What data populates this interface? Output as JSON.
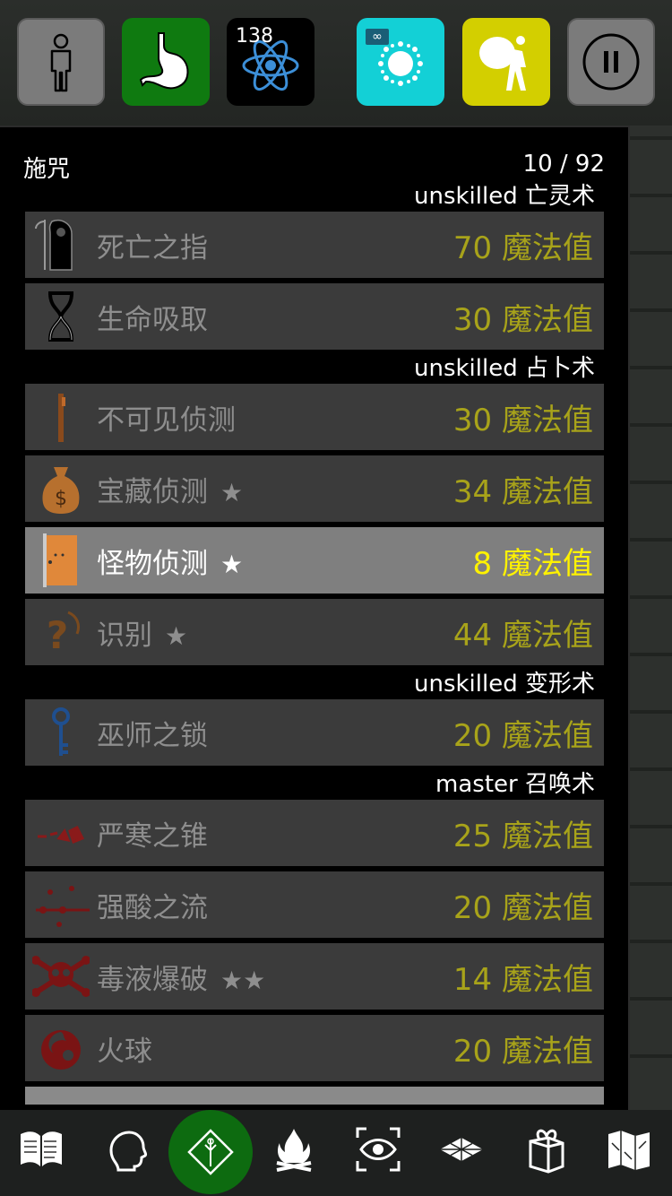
{
  "top_bar": {
    "character": {
      "icon": "person-icon"
    },
    "hunger": {
      "icon": "stomach-icon"
    },
    "radiation": {
      "icon": "atom-icon",
      "count": "138"
    },
    "status": {
      "icon": "sparkle-icon",
      "badge": "∞"
    },
    "burden": {
      "icon": "burden-icon"
    },
    "pause": {
      "icon": "pause-icon"
    }
  },
  "panel": {
    "title": "施咒",
    "count": "10 / 92"
  },
  "schools": [
    {
      "header": "unskilled 亡灵术",
      "spells": [
        {
          "name": "死亡之指",
          "stars": "",
          "cost": "70 魔法值",
          "icon": "reaper-icon",
          "selected": false
        },
        {
          "name": "生命吸取",
          "stars": "",
          "cost": "30 魔法值",
          "icon": "hourglass-icon",
          "selected": false
        }
      ]
    },
    {
      "header": "unskilled 占卜术",
      "spells": [
        {
          "name": "不可见侦测",
          "stars": "",
          "cost": "30 魔法值",
          "icon": "rod-icon",
          "selected": false
        },
        {
          "name": "宝藏侦测",
          "stars": "★",
          "cost": "34 魔法值",
          "icon": "money-bag-icon",
          "selected": false
        },
        {
          "name": "怪物侦测",
          "stars": "★",
          "cost": "8 魔法值",
          "icon": "door-icon",
          "selected": true
        },
        {
          "name": "识别",
          "stars": "★",
          "cost": "44 魔法值",
          "icon": "question-icon",
          "selected": false
        }
      ]
    },
    {
      "header": "unskilled 变形术",
      "spells": [
        {
          "name": "巫师之锁",
          "stars": "",
          "cost": "20 魔法值",
          "icon": "key-icon",
          "selected": false
        }
      ]
    },
    {
      "header": "master 召唤术",
      "spells": [
        {
          "name": "严寒之锥",
          "stars": "",
          "cost": "25 魔法值",
          "icon": "cone-icon",
          "selected": false
        },
        {
          "name": "强酸之流",
          "stars": "",
          "cost": "20 魔法值",
          "icon": "acid-icon",
          "selected": false
        },
        {
          "name": "毒液爆破",
          "stars": "★★",
          "cost": "14 魔法值",
          "icon": "skull-icon",
          "selected": false
        },
        {
          "name": "火球",
          "stars": "",
          "cost": "20 魔法值",
          "icon": "fireball-icon",
          "selected": false
        }
      ]
    }
  ],
  "bottom_bar": [
    {
      "icon": "book-icon"
    },
    {
      "icon": "head-icon"
    },
    {
      "icon": "spell-diamond-icon",
      "active": true
    },
    {
      "icon": "campfire-icon"
    },
    {
      "icon": "look-eye-icon"
    },
    {
      "icon": "floor-tiles-icon"
    },
    {
      "icon": "gift-icon"
    },
    {
      "icon": "map-icon"
    }
  ],
  "colors": {
    "selected_cost": "#fff200",
    "cost": "#a8a31a",
    "active_green": "#0d6b10"
  }
}
